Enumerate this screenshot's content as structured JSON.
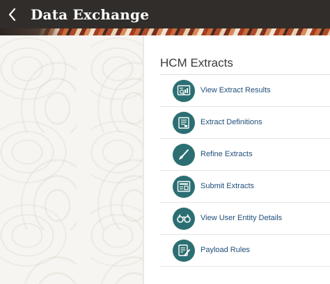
{
  "header": {
    "title": "Data Exchange",
    "back_icon": "chevron-left-icon",
    "background_color": "#312d2a"
  },
  "section": {
    "title": "HCM Extracts"
  },
  "accent_color": "#2c6f73",
  "link_color": "#1f4e79",
  "menu": {
    "items": [
      {
        "label": "View Extract Results",
        "icon": "report-chart-icon"
      },
      {
        "label": "Extract Definitions",
        "icon": "document-list-icon"
      },
      {
        "label": "Refine Extracts",
        "icon": "brush-icon"
      },
      {
        "label": "Submit Extracts",
        "icon": "form-submit-icon"
      },
      {
        "label": "View User Entity Details",
        "icon": "binoculars-icon"
      },
      {
        "label": "Payload Rules",
        "icon": "document-edit-icon"
      }
    ]
  }
}
